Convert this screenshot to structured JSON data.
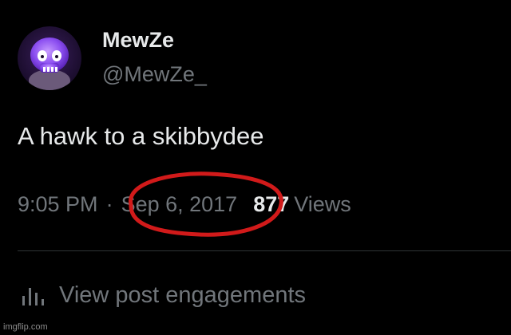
{
  "post": {
    "author": {
      "display_name": "MewZe",
      "handle": "@MewZe_"
    },
    "text": "A hawk to a skibbydee",
    "time": "9:05 PM",
    "separator": "·",
    "date": "Sep 6, 2017",
    "views_count": "877",
    "views_label": "Views"
  },
  "engagements": {
    "icon": "bar-chart-icon",
    "label": "View post engagements"
  },
  "annotation": {
    "color": "#d11a1a"
  },
  "watermark": "imgflip.com",
  "colors": {
    "background": "#000000",
    "primary_text": "#e7e9ea",
    "secondary_text": "#71767b",
    "divider": "#2f3336",
    "avatar_purple": "#7a3fd6"
  }
}
